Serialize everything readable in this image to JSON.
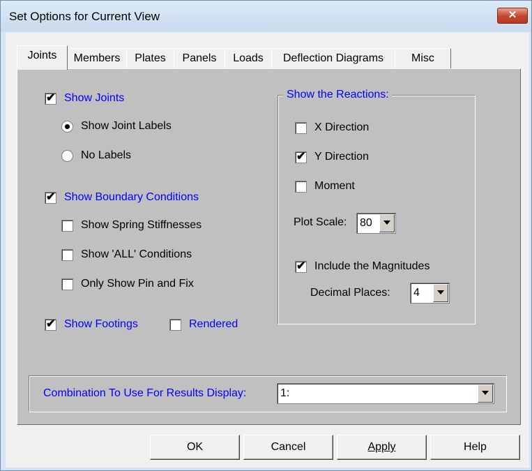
{
  "window": {
    "title": "Set Options for Current View",
    "close_glyph": "✕"
  },
  "tabs": [
    {
      "label": "Joints"
    },
    {
      "label": "Members"
    },
    {
      "label": "Plates"
    },
    {
      "label": "Panels"
    },
    {
      "label": "Loads"
    },
    {
      "label": "Deflection Diagrams"
    },
    {
      "label": "Misc"
    }
  ],
  "joints": {
    "show_joints": {
      "label": "Show Joints",
      "checked": true
    },
    "show_joint_labels": {
      "label": "Show Joint Labels",
      "selected": true
    },
    "no_labels": {
      "label": "No Labels",
      "selected": false
    },
    "show_boundary": {
      "label": "Show Boundary Conditions",
      "checked": true
    },
    "show_spring": {
      "label": "Show Spring Stiffnesses",
      "checked": false
    },
    "show_all": {
      "label": "Show 'ALL' Conditions",
      "checked": false
    },
    "only_pin": {
      "label": "Only Show Pin and Fix",
      "checked": false
    },
    "show_footings": {
      "label": "Show Footings",
      "checked": true
    },
    "rendered": {
      "label": "Rendered",
      "checked": false
    }
  },
  "reactions": {
    "title": "Show the Reactions:",
    "x_direction": {
      "label": "X Direction",
      "checked": false
    },
    "y_direction": {
      "label": "Y Direction",
      "checked": true
    },
    "moment": {
      "label": "Moment",
      "checked": false
    },
    "plot_scale_label": "Plot Scale:",
    "plot_scale_value": "80",
    "include_magnitudes": {
      "label": "Include the Magnitudes",
      "checked": true
    },
    "decimal_places_label": "Decimal Places:",
    "decimal_places_value": "4"
  },
  "combination": {
    "label": "Combination To Use For Results Display:",
    "value": "1:"
  },
  "buttons": {
    "ok": "OK",
    "cancel": "Cancel",
    "apply": "Apply",
    "help": "Help"
  },
  "check_glyph": "✔",
  "colors": {
    "panel": "#c0c0c0",
    "label_blue": "#0000ff",
    "close_red": "#c4442a"
  }
}
